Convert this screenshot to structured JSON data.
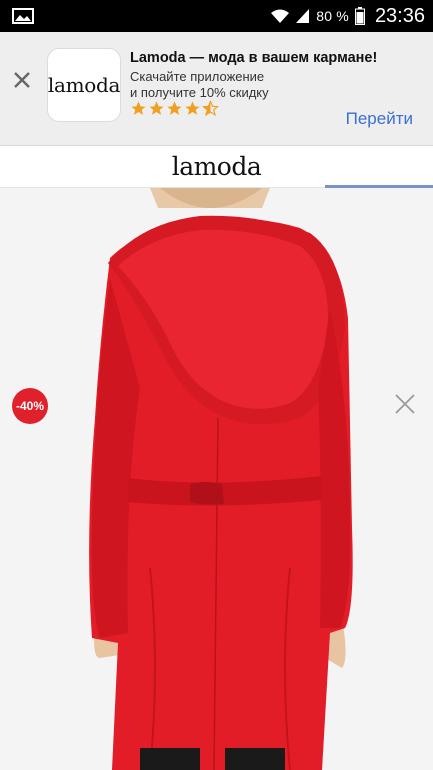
{
  "status_bar": {
    "battery_percent": "80 %",
    "time": "23:36",
    "icons": [
      "picture-icon",
      "wifi-icon",
      "signal-icon",
      "battery-icon"
    ]
  },
  "app_banner": {
    "app_icon_text": "lamoda",
    "title": "Lamoda — мода в вашем кармане!",
    "subtitle_line1": "Скачайте приложение",
    "subtitle_line2": "и получите 10% скидку",
    "rating": 4.5,
    "cta_label": "Перейти",
    "colors": {
      "cta": "#3a6fd6",
      "stars": "#f0a020"
    }
  },
  "header": {
    "logo": "lamoda"
  },
  "product": {
    "discount_label": "-40%",
    "colors": {
      "badge": "#e0202a",
      "coat": "#e31d28"
    }
  }
}
